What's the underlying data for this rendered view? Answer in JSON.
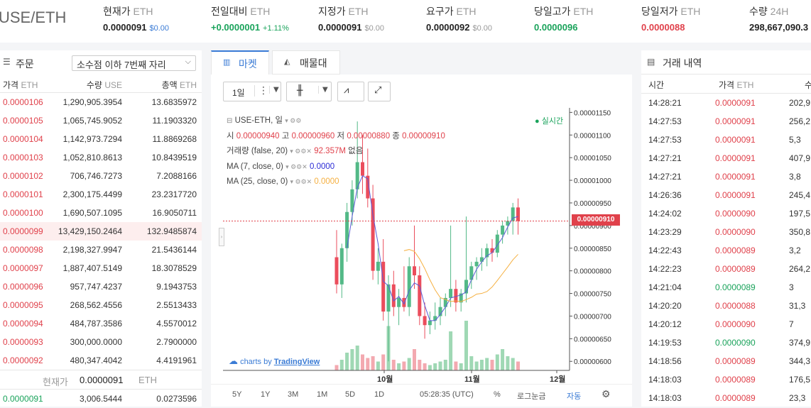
{
  "header": {
    "pair": "USE/ETH",
    "stats": [
      {
        "label": "현재가",
        "unit": "ETH",
        "value": "0.0000091",
        "sub": "$0.00",
        "color": "#222",
        "subcolor": "#3a7bd5"
      },
      {
        "label": "전일대비",
        "unit": "ETH",
        "value": "+0.0000001",
        "sub": "+1.11%",
        "color": "#1aa35b",
        "subcolor": "#1aa35b"
      },
      {
        "label": "지정가",
        "unit": "ETH",
        "value": "0.0000091",
        "sub": "$0.00",
        "color": "#222",
        "subcolor": "#999"
      },
      {
        "label": "요구가",
        "unit": "ETH",
        "value": "0.0000092",
        "sub": "$0.00",
        "color": "#222",
        "subcolor": "#999"
      },
      {
        "label": "당일고가",
        "unit": "ETH",
        "value": "0.0000096",
        "sub": "",
        "color": "#1aa35b",
        "subcolor": "#999"
      },
      {
        "label": "당일저가",
        "unit": "ETH",
        "value": "0.0000088",
        "sub": "",
        "color": "#e0414b",
        "subcolor": "#999"
      },
      {
        "label": "수량",
        "unit": "24H",
        "value": "298,667,090.3",
        "sub": "",
        "color": "#222",
        "subcolor": "#999"
      }
    ]
  },
  "orderbook": {
    "title": "주문",
    "decimal_select": "소수점 이하 7번째 자리",
    "col_price": "가격",
    "col_price_unit": "ETH",
    "col_qty": "수량",
    "col_qty_unit": "USE",
    "col_total": "총액",
    "col_total_unit": "ETH",
    "asks": [
      {
        "price": "0.0000106",
        "qty": "1,290,905.3954",
        "total": "13.6835972"
      },
      {
        "price": "0.0000105",
        "qty": "1,065,745.9052",
        "total": "11.1903320"
      },
      {
        "price": "0.0000104",
        "qty": "1,142,973.7294",
        "total": "11.8869268"
      },
      {
        "price": "0.0000103",
        "qty": "1,052,810.8613",
        "total": "10.8439519"
      },
      {
        "price": "0.0000102",
        "qty": "706,746.7273",
        "total": "7.2088166"
      },
      {
        "price": "0.0000101",
        "qty": "2,300,175.4499",
        "total": "23.2317720"
      },
      {
        "price": "0.0000100",
        "qty": "1,690,507.1095",
        "total": "16.9050711"
      },
      {
        "price": "0.0000099",
        "qty": "13,429,150.2464",
        "total": "132.9485874"
      },
      {
        "price": "0.0000098",
        "qty": "2,198,327.9947",
        "total": "21.5436144"
      },
      {
        "price": "0.0000097",
        "qty": "1,887,407.5149",
        "total": "18.3078529"
      },
      {
        "price": "0.0000096",
        "qty": "957,747.4237",
        "total": "9.1943753"
      },
      {
        "price": "0.0000095",
        "qty": "268,562.4556",
        "total": "2.5513433"
      },
      {
        "price": "0.0000094",
        "qty": "484,787.3586",
        "total": "4.5570012"
      },
      {
        "price": "0.0000093",
        "qty": "300,000.0000",
        "total": "2.7900000"
      },
      {
        "price": "0.0000092",
        "qty": "480,347.4042",
        "total": "4.4191961"
      }
    ],
    "current_label": "현재가",
    "current_value": "0.0000091",
    "current_unit": "ETH",
    "bids": [
      {
        "price": "0.0000091",
        "qty": "3,006.5444",
        "total": "0.0273596"
      }
    ]
  },
  "chart_panel": {
    "tab_market": "마켓",
    "tab_depth": "매물대",
    "interval": "1일",
    "symbol_line": "USE-ETH, 일",
    "ohlc_o_label": "시",
    "ohlc_o": "0.00000940",
    "ohlc_h_label": "고",
    "ohlc_h": "0.00000960",
    "ohlc_l_label": "저",
    "ohlc_l": "0.00000880",
    "ohlc_c_label": "종",
    "ohlc_c": "0.00000910",
    "volume_label": "거래량 (false, 20)",
    "volume_value": "92.357M",
    "volume_suffix": "없음",
    "ma7_label": "MA (7, close, 0)",
    "ma7_value": "0.0000",
    "ma25_label": "MA (25, close, 0)",
    "ma25_value": "0.0000",
    "realtime": "실시간",
    "watermark_prefix": "charts by",
    "watermark_brand": "TradingView",
    "price_tag": "0.00000910",
    "bottom": {
      "r5y": "5Y",
      "r1y": "1Y",
      "r3m": "3M",
      "r1m": "1M",
      "r5d": "5D",
      "r1d": "1D",
      "time": "05:28:35 (UTC)",
      "pct": "%",
      "log": "로그눈금",
      "auto": "자동"
    },
    "colors": {
      "up": "#53b987",
      "down": "#eb4d5c",
      "ma7": "#5b5bd6",
      "ma25": "#f5b041"
    }
  },
  "chart_data": {
    "type": "candlestick",
    "y_ticks": [
      "0.00001150",
      "0.00001100",
      "0.00001050",
      "0.00001000",
      "0.00000950",
      "0.00000900",
      "0.00000850",
      "0.00000800",
      "0.00000750",
      "0.00000700",
      "0.00000650",
      "0.00000600"
    ],
    "x_ticks": [
      "10월",
      "11월",
      "12월"
    ],
    "ylim": [
      5.8e-06,
      1.16e-05
    ],
    "last_price": 9.1e-06,
    "candles": [
      {
        "o": 8.3e-06,
        "h": 8.9e-06,
        "l": 7.5e-06,
        "c": 7.7e-06
      },
      {
        "o": 7.7e-06,
        "h": 8.6e-06,
        "l": 7.4e-06,
        "c": 8.5e-06
      },
      {
        "o": 8.5e-06,
        "h": 9.5e-06,
        "l": 8.2e-06,
        "c": 9.3e-06
      },
      {
        "o": 9.3e-06,
        "h": 1e-05,
        "l": 9e-06,
        "c": 9.8e-06
      },
      {
        "o": 9.8e-06,
        "h": 1.13e-05,
        "l": 9.6e-06,
        "c": 1.04e-05
      },
      {
        "o": 1.04e-05,
        "h": 1.1e-05,
        "l": 9.7e-06,
        "c": 1.01e-05
      },
      {
        "o": 1.01e-05,
        "h": 1.07e-05,
        "l": 9.4e-06,
        "c": 9.6e-06
      },
      {
        "o": 9.6e-06,
        "h": 9.9e-06,
        "l": 7.8e-06,
        "c": 8e-06
      },
      {
        "o": 8e-06,
        "h": 8.5e-06,
        "l": 7.7e-06,
        "c": 8.2e-06
      },
      {
        "o": 8.2e-06,
        "h": 8.7e-06,
        "l": 6.9e-06,
        "c": 7.1e-06
      },
      {
        "o": 7.1e-06,
        "h": 7.9e-06,
        "l": 6e-06,
        "c": 7.7e-06
      },
      {
        "o": 7.7e-06,
        "h": 8e-06,
        "l": 7e-06,
        "c": 7.2e-06
      },
      {
        "o": 7.2e-06,
        "h": 7.6e-06,
        "l": 6.8e-06,
        "c": 7.4e-06
      },
      {
        "o": 7.4e-06,
        "h": 8.1e-06,
        "l": 7.1e-06,
        "c": 7.2e-06
      },
      {
        "o": 7.2e-06,
        "h": 8.3e-06,
        "l": 7e-06,
        "c": 8.1e-06
      },
      {
        "o": 8.1e-06,
        "h": 9e-06,
        "l": 7.6e-06,
        "c": 7.9e-06
      },
      {
        "o": 7.9e-06,
        "h": 8.1e-06,
        "l": 6.8e-06,
        "c": 7e-06
      },
      {
        "o": 7e-06,
        "h": 7.3e-06,
        "l": 6.5e-06,
        "c": 6.8e-06
      },
      {
        "o": 6.8e-06,
        "h": 7.1e-06,
        "l": 6.6e-06,
        "c": 6.9e-06
      },
      {
        "o": 6.9e-06,
        "h": 7.3e-06,
        "l": 6.7e-06,
        "c": 7e-06
      },
      {
        "o": 7e-06,
        "h": 7.4e-06,
        "l": 6.8e-06,
        "c": 7.2e-06
      },
      {
        "o": 7.2e-06,
        "h": 7.5e-06,
        "l": 7e-06,
        "c": 7.4e-06
      },
      {
        "o": 7.4e-06,
        "h": 9e-06,
        "l": 7.2e-06,
        "c": 7.6e-06
      },
      {
        "o": 7.6e-06,
        "h": 7.8e-06,
        "l": 7.1e-06,
        "c": 7.3e-06
      },
      {
        "o": 7.3e-06,
        "h": 7.6e-06,
        "l": 7.1e-06,
        "c": 7.5e-06
      },
      {
        "o": 7.5e-06,
        "h": 9.2e-06,
        "l": 7.3e-06,
        "c": 7.8e-06
      },
      {
        "o": 7.8e-06,
        "h": 8.2e-06,
        "l": 7.6e-06,
        "c": 8.1e-06
      },
      {
        "o": 8.1e-06,
        "h": 8.3e-06,
        "l": 7.8e-06,
        "c": 8.2e-06
      },
      {
        "o": 8.2e-06,
        "h": 8.5e-06,
        "l": 8e-06,
        "c": 8.3e-06
      },
      {
        "o": 8.3e-06,
        "h": 8.6e-06,
        "l": 8.1e-06,
        "c": 8.5e-06
      },
      {
        "o": 8.5e-06,
        "h": 8.7e-06,
        "l": 8.2e-06,
        "c": 8.4e-06
      },
      {
        "o": 8.4e-06,
        "h": 8.9e-06,
        "l": 8.3e-06,
        "c": 8.8e-06
      },
      {
        "o": 8.8e-06,
        "h": 9.1e-06,
        "l": 8.6e-06,
        "c": 9e-06
      },
      {
        "o": 9e-06,
        "h": 9.2e-06,
        "l": 8.8e-06,
        "c": 9.1e-06
      },
      {
        "o": 9.1e-06,
        "h": 9.5e-06,
        "l": 8.8e-06,
        "c": 9.4e-06
      },
      {
        "o": 9.4e-06,
        "h": 9.6e-06,
        "l": 8.8e-06,
        "c": 9.1e-06
      }
    ],
    "volumes": [
      3,
      6,
      10,
      12,
      14,
      9,
      7,
      8,
      5,
      9,
      25,
      6,
      4,
      5,
      7,
      12,
      6,
      4,
      3,
      4,
      5,
      6,
      22,
      5,
      4,
      28,
      8,
      5,
      6,
      7,
      6,
      9,
      12,
      8,
      7,
      5
    ]
  },
  "trades": {
    "title": "거래 내역",
    "col_time": "시간",
    "col_price": "가격",
    "col_price_unit": "ETH",
    "col_qty": "수",
    "rows": [
      {
        "time": "14:28:21",
        "price": "0.0000091",
        "qty": "202,9",
        "side": "sell"
      },
      {
        "time": "14:27:53",
        "price": "0.0000091",
        "qty": "256,2",
        "side": "sell"
      },
      {
        "time": "14:27:53",
        "price": "0.0000091",
        "qty": "5,3",
        "side": "sell"
      },
      {
        "time": "14:27:21",
        "price": "0.0000091",
        "qty": "407,9",
        "side": "sell"
      },
      {
        "time": "14:27:21",
        "price": "0.0000091",
        "qty": "3,8",
        "side": "sell"
      },
      {
        "time": "14:26:36",
        "price": "0.0000091",
        "qty": "245,4",
        "side": "sell"
      },
      {
        "time": "14:24:02",
        "price": "0.0000090",
        "qty": "197,5",
        "side": "sell"
      },
      {
        "time": "14:23:29",
        "price": "0.0000090",
        "qty": "350,8",
        "side": "sell"
      },
      {
        "time": "14:22:43",
        "price": "0.0000089",
        "qty": "3,2",
        "side": "sell"
      },
      {
        "time": "14:22:23",
        "price": "0.0000089",
        "qty": "264,2",
        "side": "sell"
      },
      {
        "time": "14:21:04",
        "price": "0.0000089",
        "qty": "3",
        "side": "buy"
      },
      {
        "time": "14:20:20",
        "price": "0.0000088",
        "qty": "31,3",
        "side": "sell"
      },
      {
        "time": "14:20:12",
        "price": "0.0000090",
        "qty": "7",
        "side": "sell"
      },
      {
        "time": "14:19:53",
        "price": "0.0000090",
        "qty": "374,9",
        "side": "buy"
      },
      {
        "time": "14:18:56",
        "price": "0.0000089",
        "qty": "344,3",
        "side": "sell"
      },
      {
        "time": "14:18:03",
        "price": "0.0000089",
        "qty": "176,5",
        "side": "sell"
      },
      {
        "time": "14:18:03",
        "price": "0.0000089",
        "qty": "23,3",
        "side": "sell"
      }
    ]
  }
}
